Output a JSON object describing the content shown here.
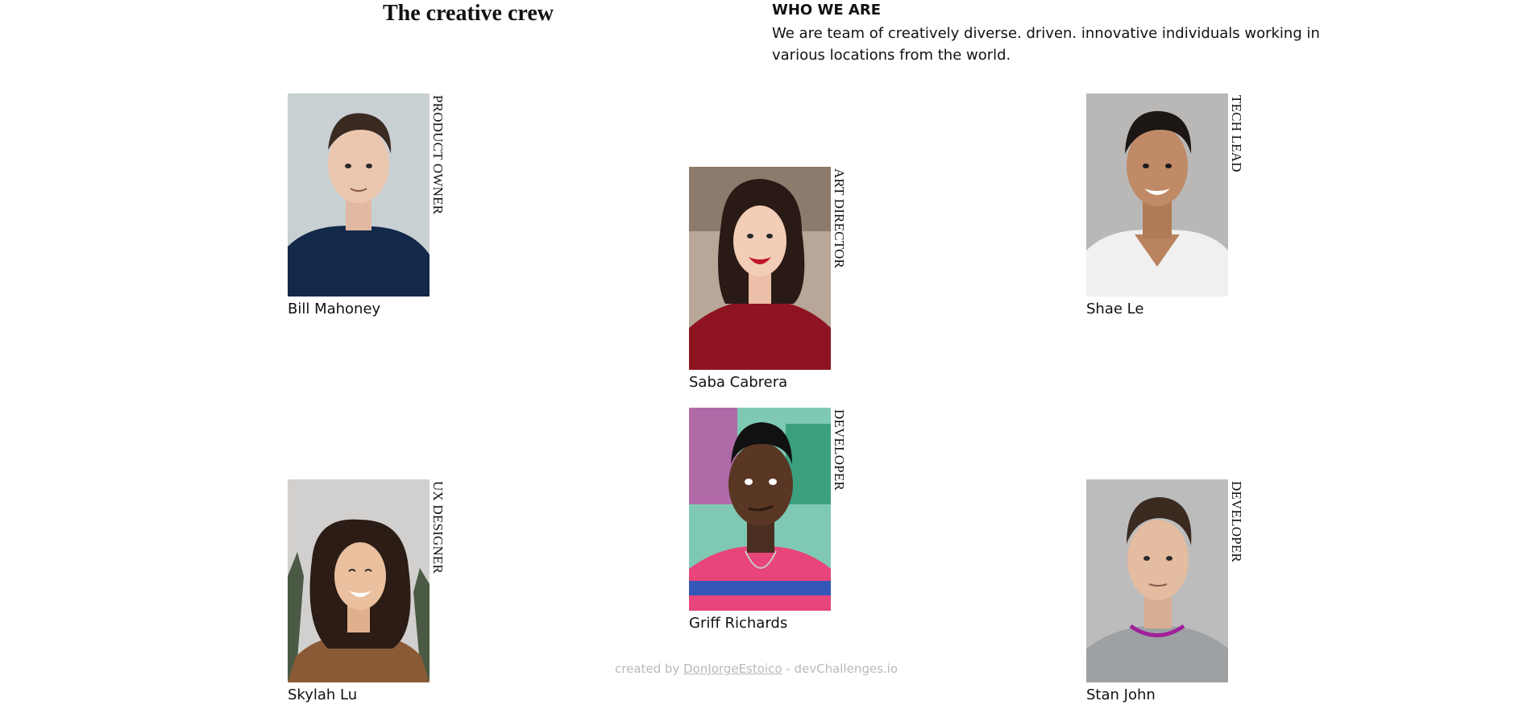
{
  "header": {
    "title": "The creative crew",
    "who_label": "WHO WE ARE",
    "who_text": "We are team of creatively diverse. driven. innovative individuals working in various locations from the world."
  },
  "members": [
    {
      "name": "Bill Mahoney",
      "role": "PRODUCT OWNER"
    },
    {
      "name": "Saba Cabrera",
      "role": "ART DIRECTOR"
    },
    {
      "name": "Shae Le",
      "role": "TECH LEAD"
    },
    {
      "name": "Skylah Lu",
      "role": "UX DESIGNER"
    },
    {
      "name": "Griff Richards",
      "role": "DEVELOPER"
    },
    {
      "name": "Stan John",
      "role": "DEVELOPER"
    }
  ],
  "footer": {
    "prefix": "created by ",
    "author": "DonJorgeEstoico",
    "suffix": " - devChallenges.io"
  },
  "colors": {
    "text": "#111111",
    "footer": "#b9b9b9",
    "background": "#ffffff"
  }
}
